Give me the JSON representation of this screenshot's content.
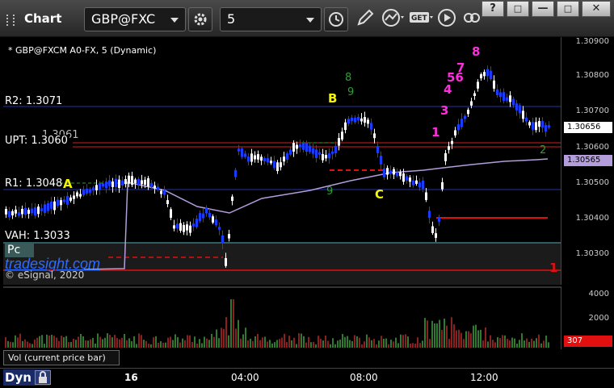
{
  "toolbar": {
    "title": "Chart",
    "symbol": "GBP@FXC",
    "interval": "5",
    "window_buttons": [
      "?",
      "□",
      "—",
      "□",
      "✕"
    ]
  },
  "chart": {
    "study_title": "* GBP@FXCM A0-FX, 5 (Dynamic)",
    "levels": {
      "r2": "R2: 1.3071",
      "upt": "UPT: 1.3060",
      "upt_under": "1.3061",
      "r1": "R1: 1.3048",
      "vah": "VAH: 1.3033",
      "pc": "Pc"
    },
    "watermark": "tradesight.com",
    "copyright": "© eSignal, 2020",
    "price_axis": [
      "1.30900",
      "1.30800",
      "1.30700",
      "1.30600",
      "1.30500",
      "1.30400",
      "1.30300"
    ],
    "last_price": "1.30656",
    "vwap_price": "1.30565",
    "volume_axis": [
      "4000",
      "2000"
    ],
    "volume_last": "307",
    "volume_study": "Vol (current price bar)",
    "time_axis": [
      "16",
      "04:00",
      "08:00",
      "12:00"
    ],
    "annotations": {
      "a": "A",
      "b": "B",
      "c": "C",
      "one_red": "1",
      "one_magenta": "1",
      "two_green": "2",
      "three": "3",
      "four": "4",
      "five_six": "56",
      "seven": "7",
      "eight": "8",
      "nine_green": "9",
      "eight_green": "8"
    },
    "tab_label": "Dyn"
  },
  "colors": {
    "up_bar": "#ffffff",
    "down_bar": "#1a3cff",
    "vwap": "#b39ddb",
    "r2_line": "#2233aa",
    "upt_line": "#d02020",
    "r1_line": "#2233aa",
    "vah_line": "#5fb7c9",
    "red_level": "#e01010",
    "annotation_yellow": "#f5f500",
    "annotation_magenta": "#ff2ddf",
    "count_green": "#2e9f2e"
  }
}
